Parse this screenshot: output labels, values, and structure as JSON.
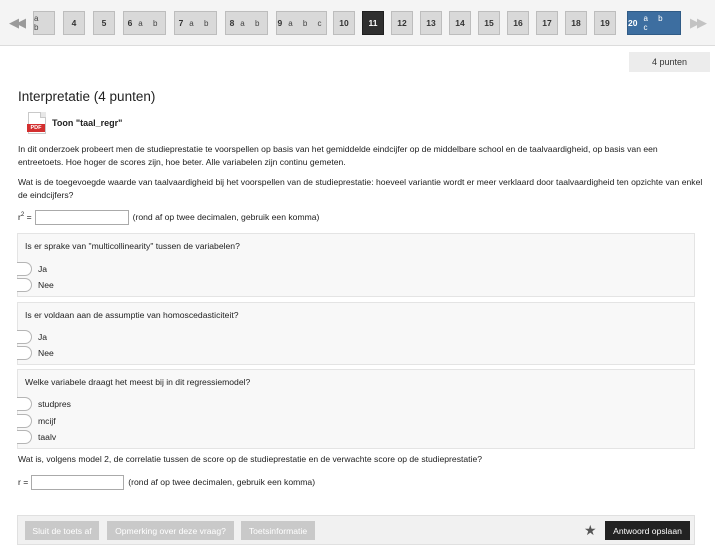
{
  "nav": {
    "prev_icon": "double-chevron-left-icon",
    "next_icon": "double-chevron-right-icon",
    "questions": [
      {
        "num": "",
        "sub": "a b",
        "state": "answered"
      },
      {
        "num": "4",
        "sub": "",
        "state": "answered"
      },
      {
        "num": "5",
        "sub": "",
        "state": "answered"
      },
      {
        "num": "6",
        "sub": "a b",
        "state": "answered"
      },
      {
        "num": "7",
        "sub": "a b",
        "state": "answered"
      },
      {
        "num": "8",
        "sub": "a b",
        "state": "answered"
      },
      {
        "num": "9",
        "sub": "a b c",
        "state": "answered"
      },
      {
        "num": "10",
        "sub": "",
        "state": "answered"
      },
      {
        "num": "11",
        "sub": "",
        "state": "current"
      },
      {
        "num": "12",
        "sub": "",
        "state": "answered"
      },
      {
        "num": "13",
        "sub": "",
        "state": "answered"
      },
      {
        "num": "14",
        "sub": "",
        "state": "answered"
      },
      {
        "num": "15",
        "sub": "",
        "state": "answered"
      },
      {
        "num": "16",
        "sub": "",
        "state": "answered"
      },
      {
        "num": "17",
        "sub": "",
        "state": "answered"
      },
      {
        "num": "18",
        "sub": "",
        "state": "answered"
      },
      {
        "num": "19",
        "sub": "",
        "state": "answered"
      },
      {
        "num": "20",
        "sub": "a b c",
        "state": "selected"
      }
    ]
  },
  "points_label": "4 punten",
  "question": {
    "title": "Interpretatie (4 punten)",
    "attachment": {
      "icon": "pdf-icon",
      "icon_text": "PDF",
      "label": "Toon \"taal_regr\""
    },
    "intro": "In dit onderzoek probeert men de studieprestatie te voorspellen op basis van het gemiddelde eindcijfer op de middelbare school en de taalvaardigheid, op basis van een entreetoets. Hoe hoger de scores zijn, hoe beter. Alle variabelen zijn continu gemeten.",
    "q1": "Wat is de toegevoegde waarde van taalvaardigheid bij het voorspellen van de studieprestatie: hoeveel variantie wordt er meer verklaard door taalvaardigheid ten opzichte van enkel de eindcijfers?",
    "r2_label": "r",
    "r2_sup": "2",
    "r2_eq": " =",
    "r2_value": "",
    "r2_hint": "(rond af op twee decimalen, gebruik een komma)",
    "panels": [
      {
        "text": "Is er sprake van \"multicollinearity\" tussen de variabelen?",
        "options": [
          "Ja",
          "Nee"
        ]
      },
      {
        "text": "Is er voldaan aan de assumptie van homoscedasticiteit?",
        "options": [
          "Ja",
          "Nee"
        ]
      },
      {
        "text": "Welke variabele draagt het meest bij in dit regressiemodel?",
        "options": [
          "studpres",
          "mcijf",
          "taalv"
        ]
      }
    ],
    "q4": "Wat is, volgens model 2, de correlatie tussen de score op de studieprestatie en de verwachte score op de studieprestatie?",
    "r_label": "r =",
    "r_value": "",
    "r_hint": "(rond af op twee decimalen, gebruik een komma)"
  },
  "footer": {
    "close_test": "Sluit de toets af",
    "remark": "Opmerking over deze vraag?",
    "test_info": "Toetsinformatie",
    "star_icon": "star-icon",
    "save": "Antwoord opslaan"
  }
}
